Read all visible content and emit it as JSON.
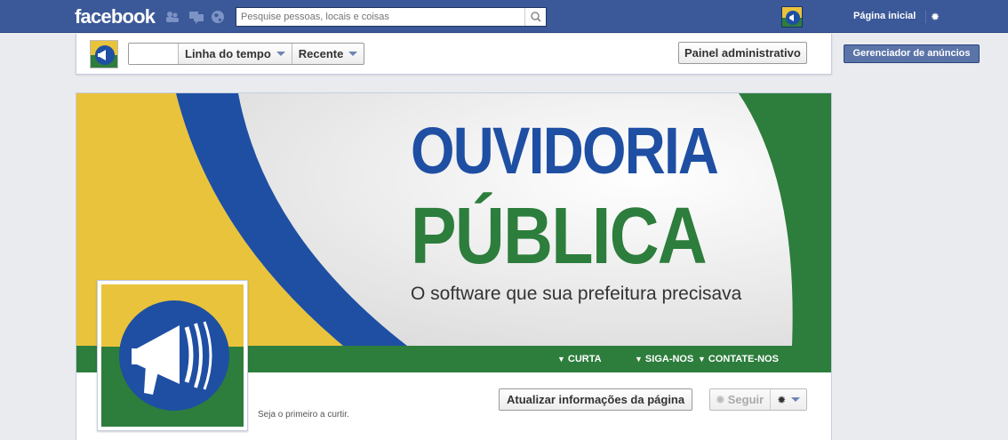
{
  "topbar": {
    "logo": "facebook",
    "search_placeholder": "Pesquise pessoas, locais e coisas",
    "home_link": "Página inicial",
    "icons": [
      "friends-icon",
      "messages-icon",
      "notifications-globe-icon",
      "search-icon",
      "gear-icon"
    ]
  },
  "admin": {
    "timeline_label": "Linha do tempo",
    "recent_label": "Recente",
    "admin_panel_label": "Painel administrativo",
    "ads_manager_label": "Gerenciador de anúncios"
  },
  "cover": {
    "title_line1": "OUVIDORIA",
    "title_line2": "PÚBLICA",
    "subtitle": "O software que sua prefeitura precisava",
    "links": [
      "CURTA",
      "SIGA-NOS",
      "CONTATE-NOS"
    ],
    "colors": {
      "yellow": "#e9c33b",
      "blue": "#1e4fa3",
      "green": "#2d7d3c"
    }
  },
  "page": {
    "update_info_label": "Atualizar informações da página",
    "follow_label": "Seguir",
    "likes_text": "Seja o primeiro a curtir."
  }
}
